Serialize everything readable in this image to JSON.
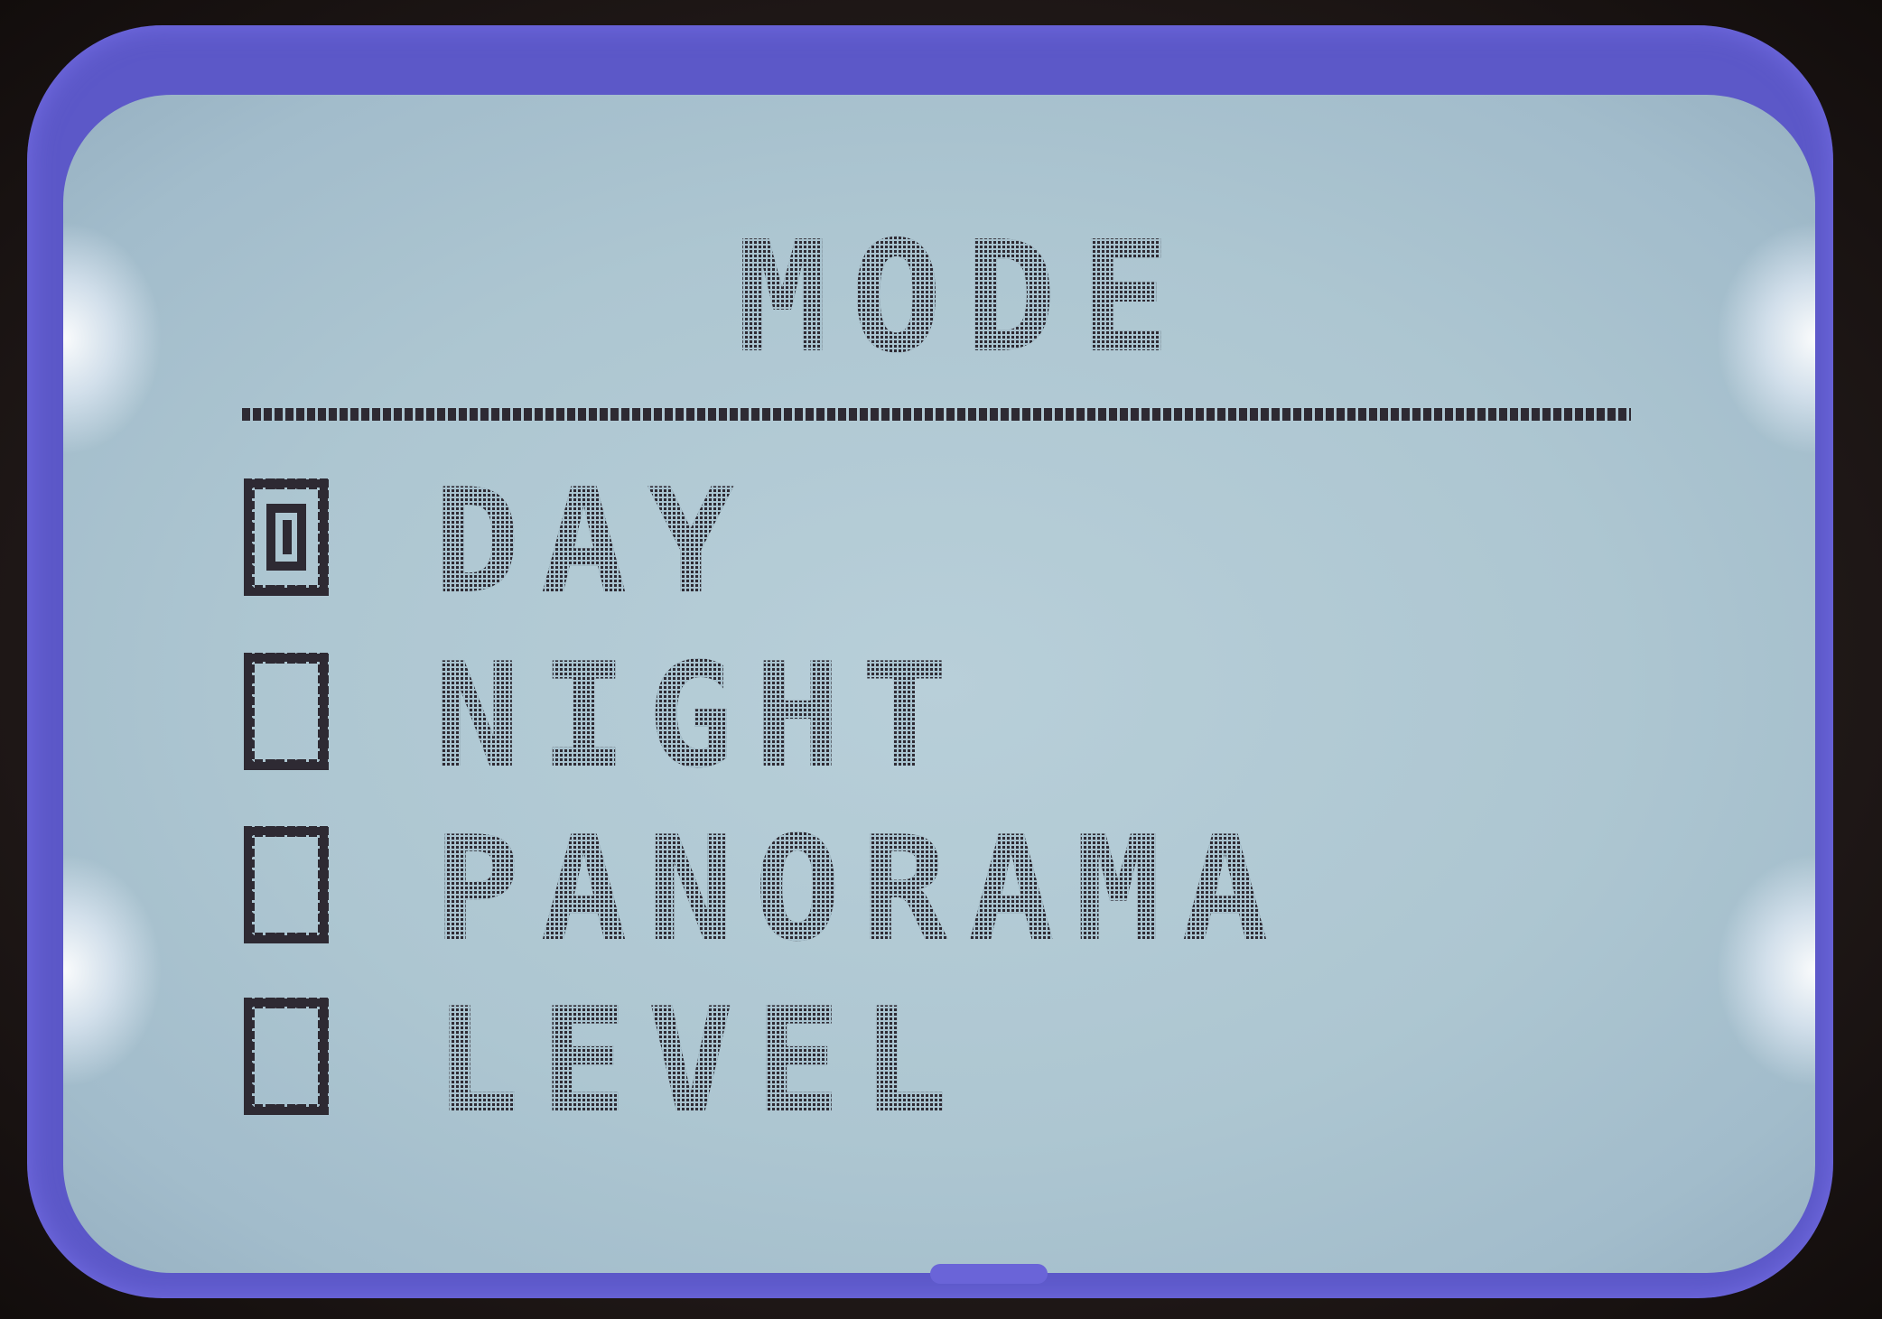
{
  "screen": {
    "title": "MODE"
  },
  "menu": {
    "items": [
      {
        "label": "DAY",
        "checked": true
      },
      {
        "label": "NIGHT",
        "checked": false
      },
      {
        "label": "PANORAMA",
        "checked": false
      },
      {
        "label": "LEVEL",
        "checked": false
      }
    ]
  },
  "colors": {
    "lcd_background": "#adc6d1",
    "pixel_ink": "#2e2a33",
    "bezel": "#5c58c8"
  }
}
